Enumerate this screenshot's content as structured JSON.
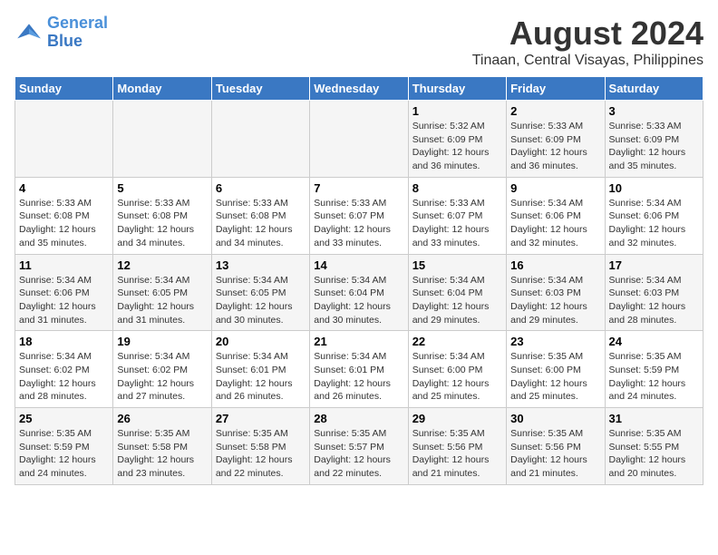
{
  "header": {
    "logo_line1": "General",
    "logo_line2": "Blue",
    "main_title": "August 2024",
    "subtitle": "Tinaan, Central Visayas, Philippines"
  },
  "calendar": {
    "days_of_week": [
      "Sunday",
      "Monday",
      "Tuesday",
      "Wednesday",
      "Thursday",
      "Friday",
      "Saturday"
    ],
    "weeks": [
      [
        {
          "day": "",
          "sunrise": "",
          "sunset": "",
          "daylight": ""
        },
        {
          "day": "",
          "sunrise": "",
          "sunset": "",
          "daylight": ""
        },
        {
          "day": "",
          "sunrise": "",
          "sunset": "",
          "daylight": ""
        },
        {
          "day": "",
          "sunrise": "",
          "sunset": "",
          "daylight": ""
        },
        {
          "day": "1",
          "sunrise": "Sunrise: 5:32 AM",
          "sunset": "Sunset: 6:09 PM",
          "daylight": "Daylight: 12 hours and 36 minutes."
        },
        {
          "day": "2",
          "sunrise": "Sunrise: 5:33 AM",
          "sunset": "Sunset: 6:09 PM",
          "daylight": "Daylight: 12 hours and 36 minutes."
        },
        {
          "day": "3",
          "sunrise": "Sunrise: 5:33 AM",
          "sunset": "Sunset: 6:09 PM",
          "daylight": "Daylight: 12 hours and 35 minutes."
        }
      ],
      [
        {
          "day": "4",
          "sunrise": "Sunrise: 5:33 AM",
          "sunset": "Sunset: 6:08 PM",
          "daylight": "Daylight: 12 hours and 35 minutes."
        },
        {
          "day": "5",
          "sunrise": "Sunrise: 5:33 AM",
          "sunset": "Sunset: 6:08 PM",
          "daylight": "Daylight: 12 hours and 34 minutes."
        },
        {
          "day": "6",
          "sunrise": "Sunrise: 5:33 AM",
          "sunset": "Sunset: 6:08 PM",
          "daylight": "Daylight: 12 hours and 34 minutes."
        },
        {
          "day": "7",
          "sunrise": "Sunrise: 5:33 AM",
          "sunset": "Sunset: 6:07 PM",
          "daylight": "Daylight: 12 hours and 33 minutes."
        },
        {
          "day": "8",
          "sunrise": "Sunrise: 5:33 AM",
          "sunset": "Sunset: 6:07 PM",
          "daylight": "Daylight: 12 hours and 33 minutes."
        },
        {
          "day": "9",
          "sunrise": "Sunrise: 5:34 AM",
          "sunset": "Sunset: 6:06 PM",
          "daylight": "Daylight: 12 hours and 32 minutes."
        },
        {
          "day": "10",
          "sunrise": "Sunrise: 5:34 AM",
          "sunset": "Sunset: 6:06 PM",
          "daylight": "Daylight: 12 hours and 32 minutes."
        }
      ],
      [
        {
          "day": "11",
          "sunrise": "Sunrise: 5:34 AM",
          "sunset": "Sunset: 6:06 PM",
          "daylight": "Daylight: 12 hours and 31 minutes."
        },
        {
          "day": "12",
          "sunrise": "Sunrise: 5:34 AM",
          "sunset": "Sunset: 6:05 PM",
          "daylight": "Daylight: 12 hours and 31 minutes."
        },
        {
          "day": "13",
          "sunrise": "Sunrise: 5:34 AM",
          "sunset": "Sunset: 6:05 PM",
          "daylight": "Daylight: 12 hours and 30 minutes."
        },
        {
          "day": "14",
          "sunrise": "Sunrise: 5:34 AM",
          "sunset": "Sunset: 6:04 PM",
          "daylight": "Daylight: 12 hours and 30 minutes."
        },
        {
          "day": "15",
          "sunrise": "Sunrise: 5:34 AM",
          "sunset": "Sunset: 6:04 PM",
          "daylight": "Daylight: 12 hours and 29 minutes."
        },
        {
          "day": "16",
          "sunrise": "Sunrise: 5:34 AM",
          "sunset": "Sunset: 6:03 PM",
          "daylight": "Daylight: 12 hours and 29 minutes."
        },
        {
          "day": "17",
          "sunrise": "Sunrise: 5:34 AM",
          "sunset": "Sunset: 6:03 PM",
          "daylight": "Daylight: 12 hours and 28 minutes."
        }
      ],
      [
        {
          "day": "18",
          "sunrise": "Sunrise: 5:34 AM",
          "sunset": "Sunset: 6:02 PM",
          "daylight": "Daylight: 12 hours and 28 minutes."
        },
        {
          "day": "19",
          "sunrise": "Sunrise: 5:34 AM",
          "sunset": "Sunset: 6:02 PM",
          "daylight": "Daylight: 12 hours and 27 minutes."
        },
        {
          "day": "20",
          "sunrise": "Sunrise: 5:34 AM",
          "sunset": "Sunset: 6:01 PM",
          "daylight": "Daylight: 12 hours and 26 minutes."
        },
        {
          "day": "21",
          "sunrise": "Sunrise: 5:34 AM",
          "sunset": "Sunset: 6:01 PM",
          "daylight": "Daylight: 12 hours and 26 minutes."
        },
        {
          "day": "22",
          "sunrise": "Sunrise: 5:34 AM",
          "sunset": "Sunset: 6:00 PM",
          "daylight": "Daylight: 12 hours and 25 minutes."
        },
        {
          "day": "23",
          "sunrise": "Sunrise: 5:35 AM",
          "sunset": "Sunset: 6:00 PM",
          "daylight": "Daylight: 12 hours and 25 minutes."
        },
        {
          "day": "24",
          "sunrise": "Sunrise: 5:35 AM",
          "sunset": "Sunset: 5:59 PM",
          "daylight": "Daylight: 12 hours and 24 minutes."
        }
      ],
      [
        {
          "day": "25",
          "sunrise": "Sunrise: 5:35 AM",
          "sunset": "Sunset: 5:59 PM",
          "daylight": "Daylight: 12 hours and 24 minutes."
        },
        {
          "day": "26",
          "sunrise": "Sunrise: 5:35 AM",
          "sunset": "Sunset: 5:58 PM",
          "daylight": "Daylight: 12 hours and 23 minutes."
        },
        {
          "day": "27",
          "sunrise": "Sunrise: 5:35 AM",
          "sunset": "Sunset: 5:58 PM",
          "daylight": "Daylight: 12 hours and 22 minutes."
        },
        {
          "day": "28",
          "sunrise": "Sunrise: 5:35 AM",
          "sunset": "Sunset: 5:57 PM",
          "daylight": "Daylight: 12 hours and 22 minutes."
        },
        {
          "day": "29",
          "sunrise": "Sunrise: 5:35 AM",
          "sunset": "Sunset: 5:56 PM",
          "daylight": "Daylight: 12 hours and 21 minutes."
        },
        {
          "day": "30",
          "sunrise": "Sunrise: 5:35 AM",
          "sunset": "Sunset: 5:56 PM",
          "daylight": "Daylight: 12 hours and 21 minutes."
        },
        {
          "day": "31",
          "sunrise": "Sunrise: 5:35 AM",
          "sunset": "Sunset: 5:55 PM",
          "daylight": "Daylight: 12 hours and 20 minutes."
        }
      ]
    ]
  }
}
